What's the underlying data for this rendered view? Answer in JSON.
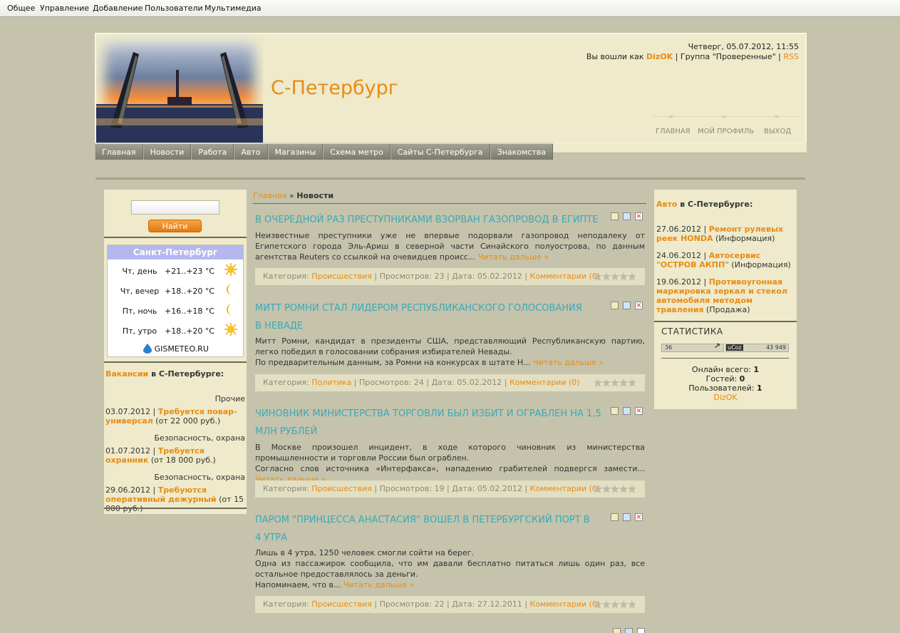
{
  "admin_bar": [
    "Общее",
    "Управление",
    "Добавление",
    "Пользователи",
    "Мультимедиа"
  ],
  "header": {
    "site_title": "С-Петербург",
    "datetime": "Четверг, 05.07.2012, 11:55",
    "login_prefix": "Вы вошли как",
    "username": "DizOK",
    "group_text": " | Группа \"Проверенные\" | ",
    "rss": "RSS",
    "nav": [
      "ГЛАВНАЯ",
      "МОЙ ПРОФИЛЬ",
      "ВЫХОД"
    ]
  },
  "main_menu": [
    "Главная",
    "Новости",
    "Работа",
    "Авто",
    "Магазины",
    "Схема метро",
    "Сайты С-Петербурга",
    "Знакомства"
  ],
  "search": {
    "button": "Найти",
    "value": ""
  },
  "weather": {
    "title": "Санкт-Петербург",
    "rows": [
      {
        "day": "Чт, день",
        "temp": "+21..+23 °C",
        "icon": "sun-icon"
      },
      {
        "day": "Чт, вечер",
        "temp": "+18..+20 °C",
        "icon": "moon-icon"
      },
      {
        "day": "Пт, ночь",
        "temp": "+16..+18 °C",
        "icon": "moon-icon"
      },
      {
        "day": "Пт, утро",
        "temp": "+18..+20 °C",
        "icon": "sun-icon"
      }
    ],
    "source": "GISMETEO.RU"
  },
  "vacancies": {
    "title_link": "Вакансии",
    "title_rest": " в С-Петербурге:",
    "items": [
      {
        "cat": "Прочие",
        "date": "03.07.2012 | ",
        "title": "Требуется повар-универсал",
        "extra": " (от 22 000 руб.)"
      },
      {
        "cat": "Безопасность, охрана",
        "date": "01.07.2012 | ",
        "title": "Требуется охранник",
        "extra": " (от 18 000 руб.)"
      },
      {
        "cat": "Безопасность, охрана",
        "date": "29.06.2012 | ",
        "title": "Требуются оперативный дежурный",
        "extra": " (от 15 000 руб.)"
      }
    ]
  },
  "breadcrumb": {
    "home": "Главная",
    "sep": " » ",
    "current": "Новости"
  },
  "articles": [
    {
      "title": "В ОЧЕРЕДНОЙ РАЗ ПРЕСТУПНИКАМИ ВЗОРВАН ГАЗОПРОВОД В ЕГИПТЕ",
      "text": "Неизвестные преступники уже не впервые подорвали газопровод неподалеку от Египетского города Эль-Ариш в северной части Синайского полуострова, по данным агентства Reuters со ссылкой на очевидцев происс...",
      "read_more": "Читать дальше »",
      "cat_label": "Категория: ",
      "category": "Происшествия",
      "views": " | Просмотров: 23 | Дата: 05.02.2012 | ",
      "comments": "Комментарии (0)"
    },
    {
      "title": "МИТТ РОМНИ СТАЛ ЛИДЕРОМ РЕСПУБЛИКАНСКОГО ГОЛОСОВАНИЯ В НЕВАДЕ",
      "text": "Митт Ромни, кандидат в президенты США, представляющий Республиканскую партию, легко победил в голосовании собрания избирателей Невады.",
      "text2": "По предварительным данным, за Ромни на конкурсах в штате Н...",
      "read_more": "Читать дальше »",
      "cat_label": "Категория: ",
      "category": "Политика",
      "views": " | Просмотров: 24 | Дата: 05.02.2012 | ",
      "comments": "Комментарии (0)"
    },
    {
      "title": "ЧИНОВНИК МИНИСТЕРСТВА ТОРГОВЛИ БЫЛ ИЗБИТ И ОГРАБЛЕН НА 1,5 МЛН РУБЛЕЙ",
      "text": "В Москве произошел инцидент, в ходе которого чиновник из министерства промышленности и торговли России был ограблен.",
      "text2": "Согласно слов источника «Интерфакса», нападению грабителей подвергся замести...",
      "read_more": "Читать дальше »",
      "cat_label": "Категория: ",
      "category": "Происшествия",
      "views": " | Просмотров: 19 | Дата: 05.02.2012 | ",
      "comments": "Комментарии (0)"
    },
    {
      "title": "ПАРОМ \"ПРИНЦЕССА АНАСТАСИЯ\" ВОШЕЛ В ПЕТЕРБУРГСКИЙ ПОРТ В 4 УТРА",
      "text": "Лишь в 4 утра, 1250 человек смогли сойти на берег.",
      "text2": "Одна из пассажирок сообщила, что им давали бесплатно питаться лишь один раз, все остальное предоставлялось за деньги.",
      "text3": "Напоминаем, что в...",
      "read_more": "Читать дальше »",
      "cat_label": "Категория: ",
      "category": "Происшествия",
      "views": " | Просмотров: 22 | Дата: 27.12.2011 | ",
      "comments": "Комментарии (0)"
    }
  ],
  "auto": {
    "title_link": "Авто",
    "title_rest": " в С-Петербурге:",
    "items": [
      {
        "date": "27.06.2012 | ",
        "title": "Ремонт рулевых реек HONDA",
        "tag": " (Информация)"
      },
      {
        "date": "24.06.2012 | ",
        "title": "Автосервис \"ОСТРОВ АКПП\"",
        "tag": " (Информация)"
      },
      {
        "date": "19.06.2012 | ",
        "title": "Противоугонная маркировка зеркал и стекол автомобиля методом травления",
        "tag": " (Продажа)"
      }
    ]
  },
  "stats": {
    "title": "СТАТИСТИКА",
    "counter_left": "36",
    "counter_brand": "uCoz",
    "counter_right": "43 949",
    "online_label": "Онлайн всего: ",
    "online": "1",
    "guests_label": "Гостей: ",
    "guests": "0",
    "users_label": "Пользователей: ",
    "users": "1",
    "user": "DizOK"
  },
  "colors": {
    "accent": "#e98b12",
    "title": "#3aa9b6",
    "page_bg": "#c5c3ac",
    "panel_bg": "#eeeacb"
  }
}
